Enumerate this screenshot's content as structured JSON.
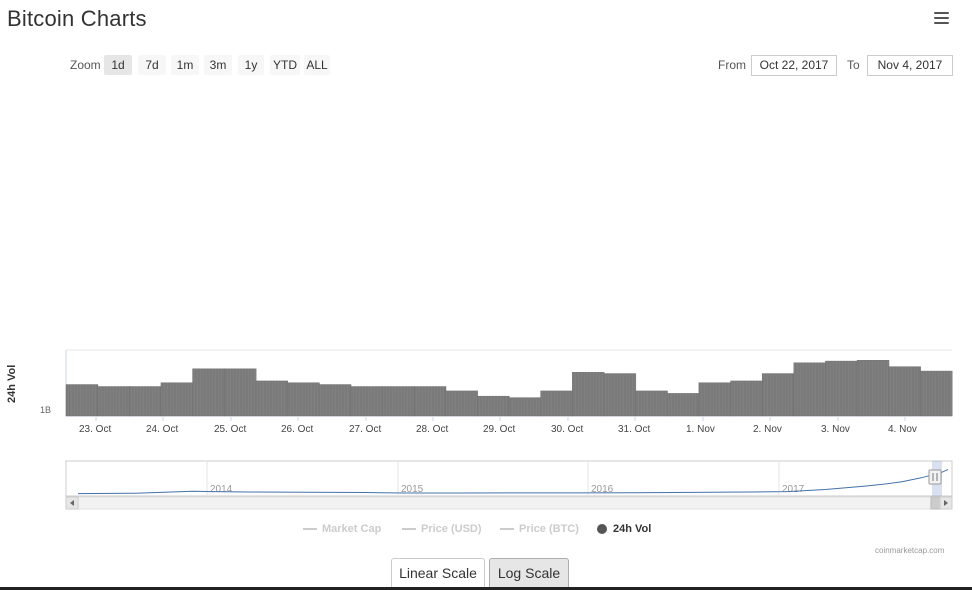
{
  "page_title": "Bitcoin Charts",
  "zoom": {
    "label": "Zoom",
    "buttons": [
      "1d",
      "7d",
      "1m",
      "3m",
      "1y",
      "YTD",
      "ALL"
    ],
    "active": "1d"
  },
  "range": {
    "from_label": "From",
    "from_value": "Oct 22, 2017",
    "to_label": "To",
    "to_value": "Nov 4, 2017"
  },
  "scale_buttons": {
    "linear": "Linear Scale",
    "log": "Log Scale",
    "active": "Log Scale"
  },
  "credits": "coinmarketcap.com",
  "colors": {
    "volume_bar": "#808080",
    "navigator_line": "#4572a7",
    "inactive_legend": "#cccccc",
    "active_legend": "#333333"
  },
  "chart_data": [
    {
      "type": "bar",
      "title": "",
      "ylabel": "24h Vol",
      "scale": "log",
      "y_tick_labels": [
        "1B"
      ],
      "x_tick_labels": [
        "23. Oct",
        "24. Oct",
        "25. Oct",
        "26. Oct",
        "27. Oct",
        "28. Oct",
        "29. Oct",
        "30. Oct",
        "31. Oct",
        "1. Nov",
        "2. Nov",
        "3. Nov",
        "4. Nov"
      ],
      "x": [
        "Oct 22",
        "Oct 22 12h",
        "Oct 23",
        "Oct 23 12h",
        "Oct 24",
        "Oct 24 12h",
        "Oct 25",
        "Oct 25 12h",
        "Oct 26",
        "Oct 26 12h",
        "Oct 27",
        "Oct 27 12h",
        "Oct 28",
        "Oct 28 12h",
        "Oct 29",
        "Oct 29 12h",
        "Oct 30",
        "Oct 30 12h",
        "Oct 31",
        "Oct 31 12h",
        "Nov 1",
        "Nov 1 12h",
        "Nov 2",
        "Nov 2 12h",
        "Nov 3",
        "Nov 3 12h",
        "Nov 4",
        "Nov 4 12h"
      ],
      "series": [
        {
          "name": "24h Vol",
          "values": [
            1.5,
            1.4,
            1.4,
            1.6,
            2.6,
            2.6,
            1.7,
            1.6,
            1.5,
            1.4,
            1.4,
            1.4,
            1.2,
            1.0,
            0.95,
            1.2,
            2.3,
            2.2,
            1.2,
            1.1,
            1.6,
            1.7,
            2.2,
            3.2,
            3.4,
            3.5,
            2.8,
            2.4
          ]
        }
      ],
      "legend": [
        {
          "name": "Market Cap",
          "active": false
        },
        {
          "name": "Price (USD)",
          "active": false
        },
        {
          "name": "Price (BTC)",
          "active": false
        },
        {
          "name": "24h Vol",
          "active": true
        }
      ]
    },
    {
      "type": "line",
      "title": "",
      "x_tick_labels": [
        "2014",
        "2015",
        "2016",
        "2017"
      ],
      "x": [
        2013.3,
        2013.6,
        2013.9,
        2014.0,
        2014.2,
        2014.5,
        2014.8,
        2015.0,
        2015.3,
        2015.6,
        2015.9,
        2016.2,
        2016.5,
        2016.8,
        2017.0,
        2017.2,
        2017.4,
        2017.5,
        2017.6,
        2017.7,
        2017.8,
        2017.84
      ],
      "series": [
        {
          "name": "",
          "values": [
            0.05,
            0.1,
            0.35,
            0.3,
            0.25,
            0.22,
            0.18,
            0.12,
            0.12,
            0.13,
            0.14,
            0.15,
            0.2,
            0.25,
            0.3,
            0.55,
            0.95,
            1.2,
            1.5,
            2.0,
            2.6,
            3.0
          ]
        }
      ]
    }
  ]
}
